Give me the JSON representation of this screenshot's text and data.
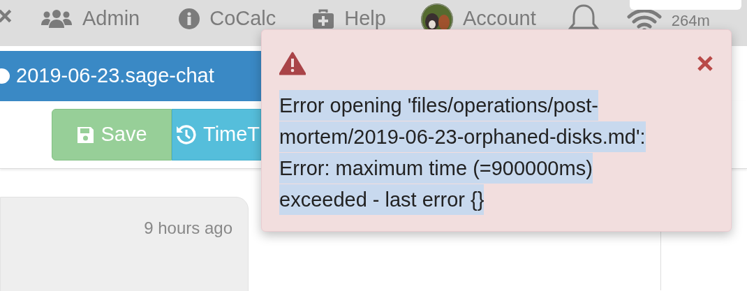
{
  "top_bar": {
    "items": [
      {
        "kind": "close"
      },
      {
        "kind": "users",
        "label": "Admin"
      },
      {
        "kind": "info",
        "label": "CoCalc"
      },
      {
        "kind": "medkit",
        "label": "Help"
      },
      {
        "kind": "avatar",
        "label": "Account"
      },
      {
        "kind": "bell"
      },
      {
        "kind": "wifi"
      }
    ],
    "ping": "264m"
  },
  "file_tab": {
    "title": "2019-06-23.sage-chat"
  },
  "toolbar": {
    "buttons": [
      {
        "kind": "save",
        "label": "Save"
      },
      {
        "kind": "timetravel",
        "label": "TimeT"
      }
    ]
  },
  "chat": {
    "messages": [
      {
        "time": "9 hours ago"
      }
    ]
  },
  "error_popup": {
    "message": "Error opening 'files/operations/post-mortem/2019-06-23-orphaned-disks.md': Error: maximum time (=900000ms) exceeded - last error {}"
  }
}
